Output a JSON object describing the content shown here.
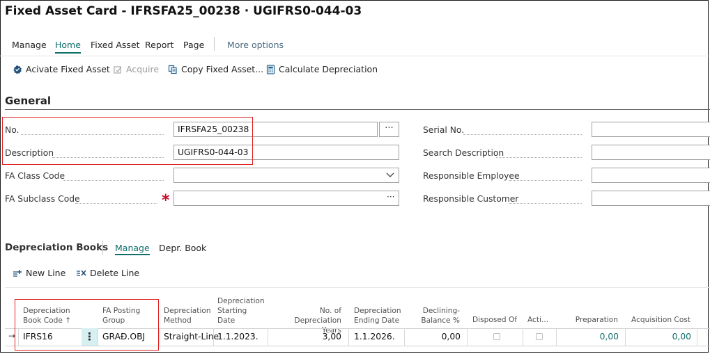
{
  "page": {
    "title": "Fixed Asset Card - IFRSFA25_00238 · UGIFRS0-044-03"
  },
  "menu": {
    "items": [
      "Manage",
      "Home",
      "Fixed Asset",
      "Report",
      "Page"
    ],
    "active": "Home",
    "more": "More options"
  },
  "actions": {
    "activate": "Acivate Fixed Asset",
    "acquire": "Acquire",
    "copy": "Copy Fixed Asset...",
    "calculate": "Calculate Depreciation"
  },
  "general": {
    "title": "General",
    "no_label": "No.",
    "no_value": "IFRSFA25_00238",
    "ellipsis": "···",
    "description_label": "Description",
    "description_value": "UGIFRS0-044-03",
    "fa_class_label": "FA Class Code",
    "fa_class_value": "",
    "fa_subclass_label": "FA Subclass Code",
    "fa_subclass_value": "",
    "subclass_ellipsis": "···",
    "serial_label": "Serial No.",
    "search_desc_label": "Search Description",
    "resp_employee_label": "Responsible Employee",
    "resp_customer_label": "Responsible Customer"
  },
  "depr_books": {
    "title": "Depreciation Books",
    "tabs": [
      "Manage",
      "Depr. Book"
    ],
    "active_tab": "Manage",
    "new_line": "New Line",
    "delete_line": "Delete Line",
    "headers": {
      "book_code_1": "Depreciation",
      "book_code_2": "Book Code ↑",
      "posting_group_1": "FA Posting",
      "posting_group_2": "Group",
      "method_1": "Depreciation",
      "method_2": "Method",
      "start_1": "Depreciation",
      "start_2": "Starting",
      "start_3": "Date",
      "years_1": "No. of Depreciation",
      "years_2": "Years",
      "end_1": "Depreciation",
      "end_2": "Ending Date",
      "declining_1": "Declining-",
      "declining_2": "Balance %",
      "disposed": "Disposed Of",
      "active": "Acti...",
      "preparation": "Preparation",
      "acquisition": "Acquisition Cost"
    },
    "row": {
      "arrow": "→",
      "kebab": "⋮",
      "book_code": "IFRS16",
      "posting_group": "GRAĐ.OBJ",
      "method": "Straight-Line",
      "start_date": "1.1.2023.",
      "years": "3,00",
      "end_date": "1.1.2026.",
      "declining": "0,00",
      "disposed": false,
      "active": false,
      "preparation": "0,00",
      "acquisition": "0,00"
    }
  }
}
